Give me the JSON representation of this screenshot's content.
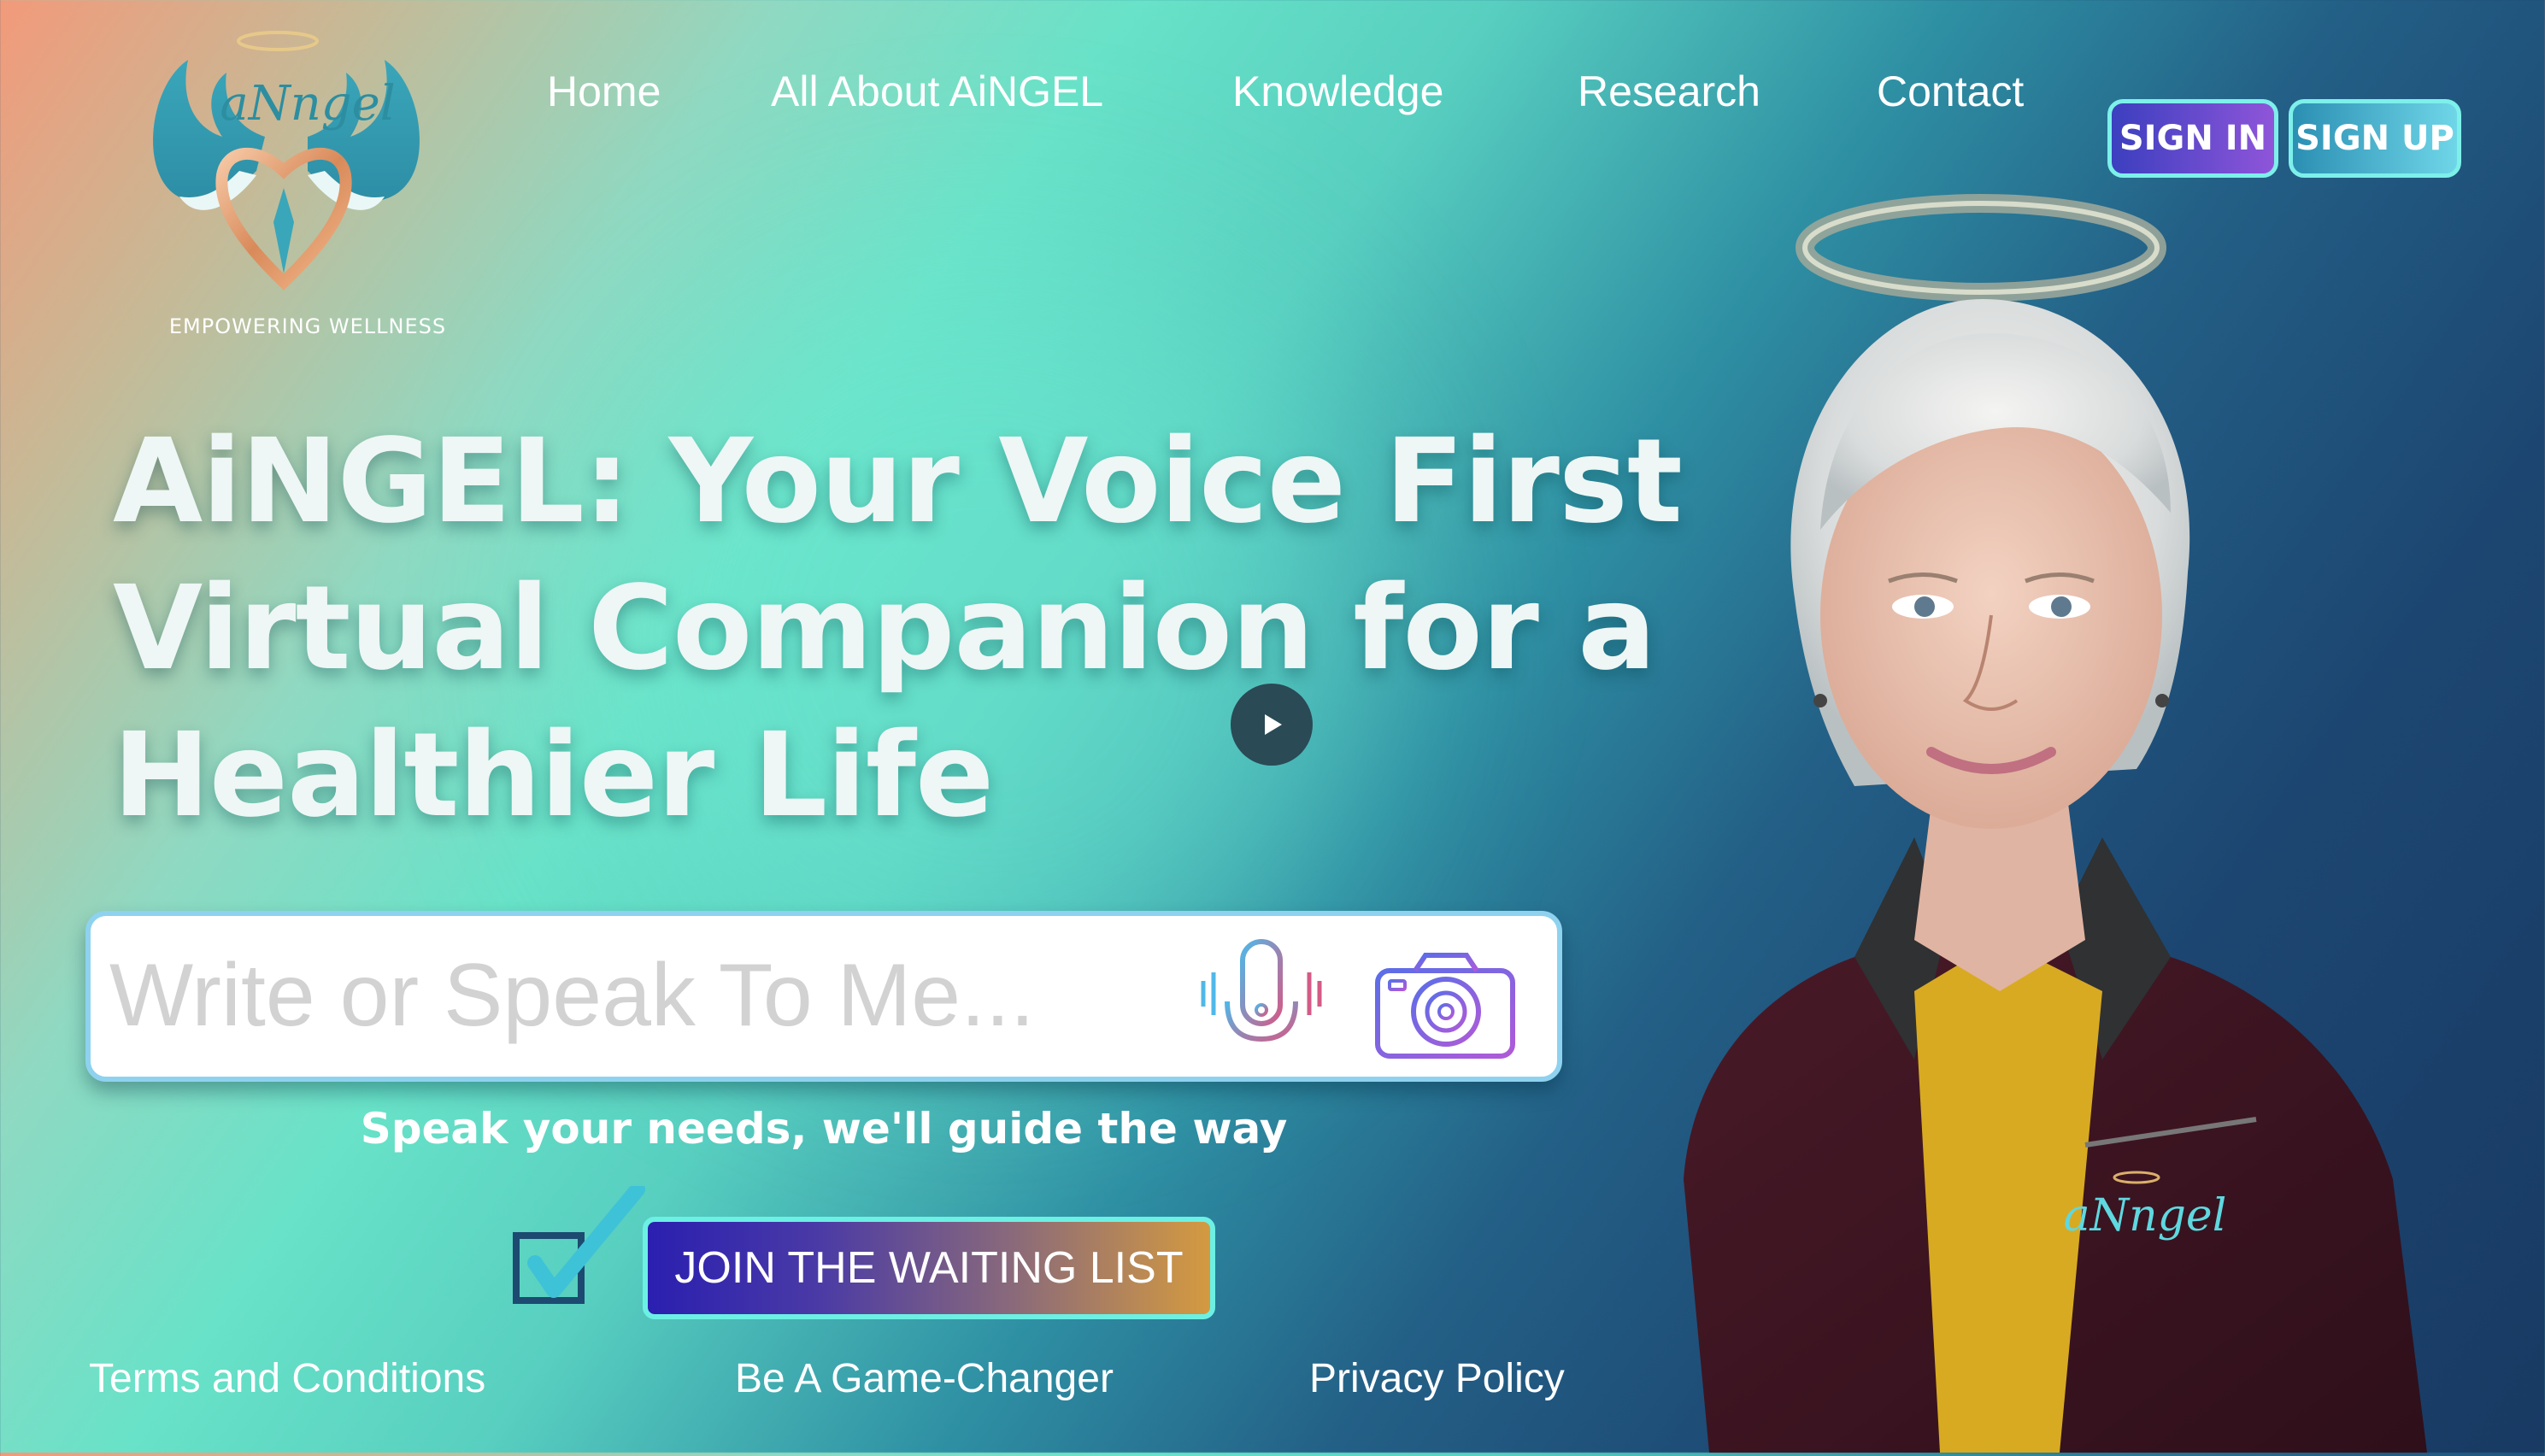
{
  "brand": {
    "logo_text": "aNngel",
    "tagline": "EMPOWERING WELLNESS"
  },
  "nav": {
    "items": [
      {
        "label": "Home"
      },
      {
        "label": "All About AiNGEL"
      },
      {
        "label": "Knowledge"
      },
      {
        "label": "Research"
      },
      {
        "label": "Contact"
      }
    ]
  },
  "auth": {
    "sign_in": "SIGN IN",
    "sign_up": "SIGN UP"
  },
  "hero": {
    "headline_lines": [
      "AiNGEL: Your Voice First",
      "Virtual Companion for a",
      "Healthier Life"
    ]
  },
  "search": {
    "placeholder": "Write or Speak To Me...",
    "value": "",
    "mic_icon": "microphone-icon",
    "camera_icon": "camera-icon"
  },
  "subtitle": "Speak your needs, we'll guide the way",
  "cta": {
    "join_label": "JOIN THE WAITING LIST"
  },
  "footer": {
    "links": [
      {
        "label": "Terms and Conditions"
      },
      {
        "label": "Be A Game-Changer"
      },
      {
        "label": "Privacy Policy"
      }
    ]
  },
  "portrait": {
    "jacket_logo": "aNngel"
  },
  "colors": {
    "accent_teal": "#6cf0e4",
    "headline": "#eef7f5",
    "navy": "#183a63"
  }
}
